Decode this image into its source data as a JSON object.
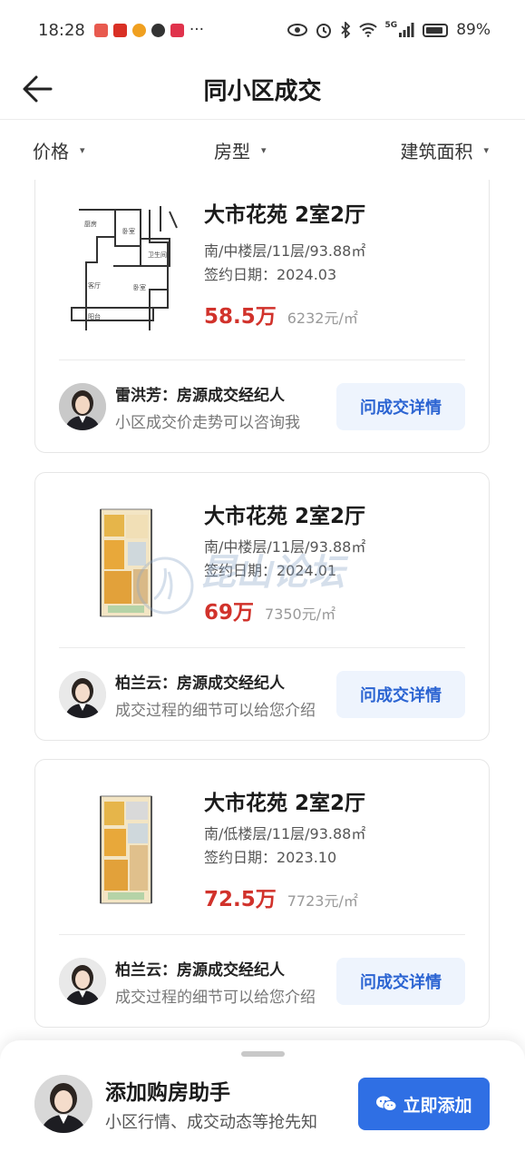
{
  "status_bar": {
    "time": "18:28",
    "more": "···",
    "network": "5G",
    "battery": "89%"
  },
  "nav": {
    "title": "同小区成交"
  },
  "filters": [
    {
      "label": "价格"
    },
    {
      "label": "房型"
    },
    {
      "label": "建筑面积"
    }
  ],
  "listings": [
    {
      "title": "大市花苑 2室2厅",
      "meta": "南/中楼层/11层/93.88㎡",
      "date": "签约日期：2024.03",
      "price": "58.5万",
      "unit_price": "6232元/㎡",
      "agent_name": "雷洪芳：房源成交经纪人",
      "agent_message": "小区成交价走势可以咨询我",
      "button": "问成交详情"
    },
    {
      "title": "大市花苑 2室2厅",
      "meta": "南/中楼层/11层/93.88㎡",
      "date": "签约日期：2024.01",
      "price": "69万",
      "unit_price": "7350元/㎡",
      "agent_name": "柏兰云：房源成交经纪人",
      "agent_message": "成交过程的细节可以给您介绍",
      "button": "问成交详情"
    },
    {
      "title": "大市花苑 2室2厅",
      "meta": "南/低楼层/11层/93.88㎡",
      "date": "签约日期：2023.10",
      "price": "72.5万",
      "unit_price": "7723元/㎡",
      "agent_name": "柏兰云：房源成交经纪人",
      "agent_message": "成交过程的细节可以给您介绍",
      "button": "问成交详情"
    }
  ],
  "watermark": {
    "text": "昆山论坛"
  },
  "helper": {
    "title": "添加购房助手",
    "subtitle": "小区行情、成交动态等抢先知",
    "button": "立即添加"
  },
  "colors": {
    "price_red": "#d1322b",
    "accent_blue": "#2f6fe4",
    "button_bg_light": "#eef4fd"
  }
}
